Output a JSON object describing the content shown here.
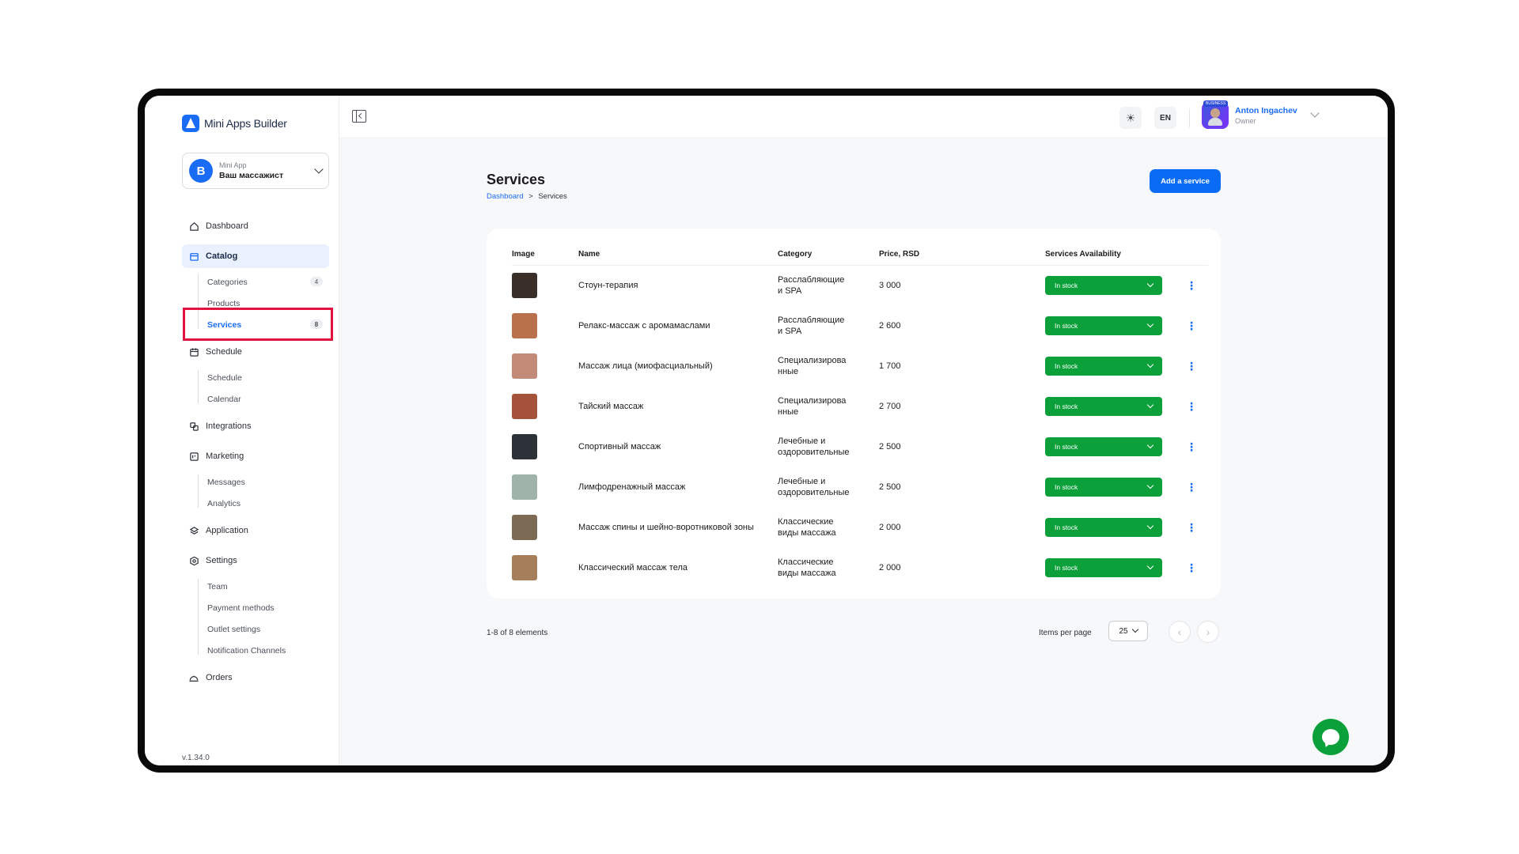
{
  "brand": {
    "name": "Mini Apps Builder",
    "accent": "#1a6cf5"
  },
  "app_select": {
    "avatar_letter": "B",
    "caption": "Mini App",
    "name": "Ваш массажист"
  },
  "nav": {
    "dashboard": "Dashboard",
    "catalog": "Catalog",
    "categories": "Categories",
    "categories_count": "4",
    "products": "Products",
    "services": "Services",
    "services_count": "8",
    "schedule": "Schedule",
    "schedule_sub": "Schedule",
    "calendar": "Calendar",
    "integrations": "Integrations",
    "marketing": "Marketing",
    "messages": "Messages",
    "analytics": "Analytics",
    "application": "Application",
    "settings": "Settings",
    "team": "Team",
    "payment_methods": "Payment methods",
    "outlet_settings": "Outlet settings",
    "notification_channels": "Notification Channels",
    "orders": "Orders"
  },
  "version": "v.1.34.0",
  "topbar": {
    "lang": "EN",
    "theme_icon": "sun-icon"
  },
  "user": {
    "name": "Anton Ingachev",
    "role": "Owner",
    "tag": "BUSINESS"
  },
  "page": {
    "title": "Services",
    "crumb_root": "Dashboard",
    "crumb_sep": ">",
    "crumb_current": "Services",
    "add_button": "Add a service"
  },
  "table": {
    "headers": {
      "image": "Image",
      "name": "Name",
      "category": "Category",
      "price": "Price, RSD",
      "availability": "Services Availability"
    },
    "rows": [
      {
        "name": "Стоун-терапия",
        "category1": "Расслабляющие",
        "category2": "и SPA",
        "price": "3 000",
        "availability": "In stock",
        "thumb": "#3a2e28"
      },
      {
        "name": "Релакс-массаж с аромамаслами",
        "category1": "Расслабляющие",
        "category2": "и SPA",
        "price": "2 600",
        "availability": "In stock",
        "thumb": "#b8714a"
      },
      {
        "name": "Массаж лица (миофасциальный)",
        "category1": "Специализирова",
        "category2": "нные",
        "price": "1 700",
        "availability": "In stock",
        "thumb": "#c48a78"
      },
      {
        "name": "Тайский массаж",
        "category1": "Специализирова",
        "category2": "нные",
        "price": "2 700",
        "availability": "In stock",
        "thumb": "#a5523a"
      },
      {
        "name": "Спортивный массаж",
        "category1": "Лечебные и",
        "category2": "оздоровительные",
        "price": "2 500",
        "availability": "In stock",
        "thumb": "#2d3138"
      },
      {
        "name": "Лимфодренажный массаж",
        "category1": "Лечебные и",
        "category2": "оздоровительные",
        "price": "2 500",
        "availability": "In stock",
        "thumb": "#9fb3a8"
      },
      {
        "name": "Массаж спины и шейно-воротниковой зоны",
        "category1": "Классические",
        "category2": "виды массажа",
        "price": "2 000",
        "availability": "In stock",
        "thumb": "#7d6a54"
      },
      {
        "name": "Классический массаж тела",
        "category1": "Классические",
        "category2": "виды массажа",
        "price": "2 000",
        "availability": "In stock",
        "thumb": "#a67e5c"
      }
    ]
  },
  "footer": {
    "count": "1-8 of 8 elements",
    "items_per_page_label": "Items per page",
    "items_per_page": "25"
  },
  "colors": {
    "in_stock": "#0ba03a",
    "highlight": "#e3123f"
  }
}
